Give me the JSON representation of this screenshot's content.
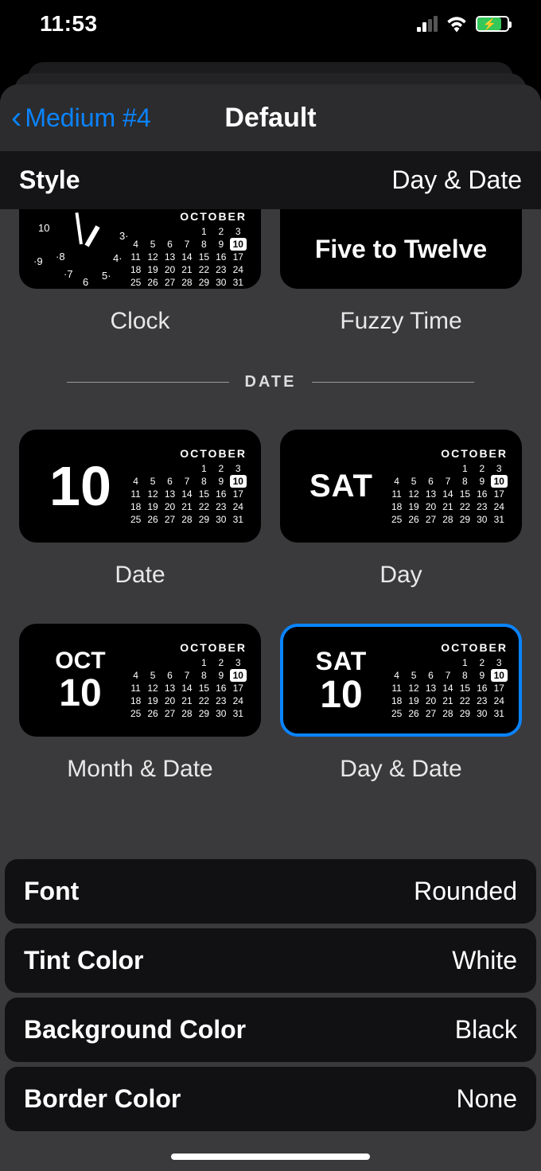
{
  "status": {
    "time": "11:53"
  },
  "nav": {
    "back_label": "Medium #4",
    "title": "Default"
  },
  "style_row": {
    "label": "Style",
    "value": "Day & Date"
  },
  "previews": {
    "clock_label": "Clock",
    "fuzzy_label": "Fuzzy Time",
    "fuzzy_text": "Five to Twelve",
    "divider": "DATE",
    "date_label": "Date",
    "day_label": "Day",
    "month_date_label": "Month & Date",
    "day_date_label": "Day & Date",
    "month_header": "OCTOBER",
    "big_date": "10",
    "big_day": "SAT",
    "big_month": "OCT",
    "calendar_rows": [
      [
        "",
        "",
        "",
        "1",
        "2",
        "3"
      ],
      [
        "4",
        "5",
        "6",
        "7",
        "8",
        "9",
        "10"
      ],
      [
        "11",
        "12",
        "13",
        "14",
        "15",
        "16",
        "17"
      ],
      [
        "18",
        "19",
        "20",
        "21",
        "22",
        "23",
        "24"
      ],
      [
        "25",
        "26",
        "27",
        "28",
        "29",
        "30",
        "31"
      ]
    ],
    "highlight_day": "10"
  },
  "settings": {
    "font": {
      "label": "Font",
      "value": "Rounded"
    },
    "tint": {
      "label": "Tint Color",
      "value": "White"
    },
    "bg": {
      "label": "Background Color",
      "value": "Black"
    },
    "border": {
      "label": "Border Color",
      "value": "None"
    }
  }
}
